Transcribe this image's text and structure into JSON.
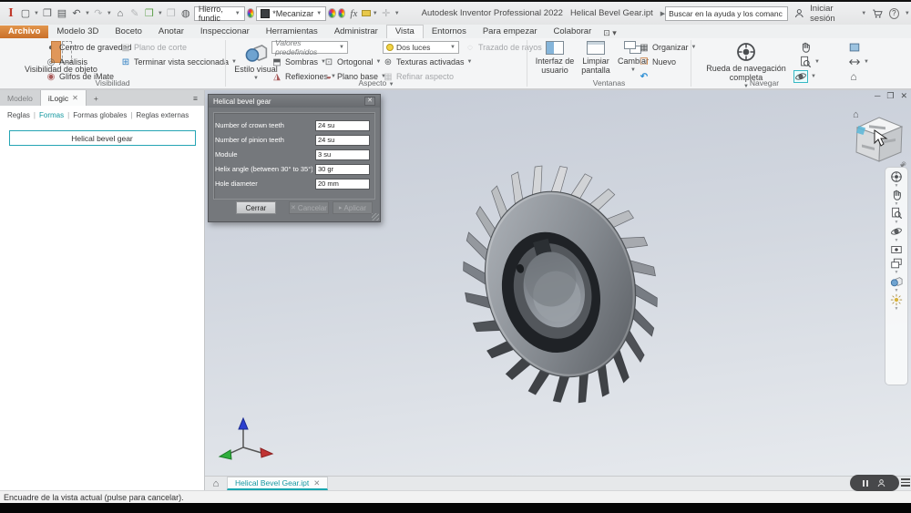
{
  "titlebar": {
    "app_title": "Autodesk Inventor Professional 2022",
    "doc_title": "Helical Bevel Gear.ipt",
    "material_dropdown": "Hierro, fundic",
    "appearance_dropdown": "*Mecanizar",
    "fx_label": "fx",
    "search_value": "Buscar en la ayuda y los comanc",
    "sign_in_label": "Iniciar sesión"
  },
  "ribbon": {
    "tabs": [
      "Archivo",
      "Modelo 3D",
      "Boceto",
      "Anotar",
      "Inspeccionar",
      "Herramientas",
      "Administrar",
      "Vista",
      "Entornos",
      "Para empezar",
      "Colaborar"
    ],
    "active_tab": "Vista",
    "visibilidad": {
      "label": "Visibilidad",
      "big_button": "Visibilidad de objeto",
      "centro": "Centro de gravedad",
      "analisis": "Análisis",
      "glifos": "Glifos de iMate",
      "plano_corte": "Plano de corte",
      "terminar": "Terminar vista seccionada"
    },
    "aspecto": {
      "label": "Aspecto",
      "big_button": "Estilo visual",
      "preset": "Valores predefinidos",
      "sombras": "Sombras",
      "ortogonal": "Ortogonal",
      "reflexiones": "Reflexiones",
      "plano_base": "Plano base",
      "luces": "Dos luces",
      "texturas": "Texturas activadas",
      "trazado": "Trazado de rayos",
      "refinar": "Refinar aspecto"
    },
    "ventanas": {
      "label": "Ventanas",
      "interfaz": "Interfaz de usuario",
      "limpiar": "Limpiar pantalla",
      "cambiar": "Cambiar",
      "organizar": "Organizar",
      "nuevo": "Nuevo"
    },
    "navegar": {
      "label": "Navegar",
      "big_button": "Rueda de navegación completa"
    }
  },
  "browser": {
    "tab_modelo": "Modelo",
    "tab_ilogic": "iLogic",
    "links": [
      "Reglas",
      "Formas",
      "Formas globales",
      "Reglas externas"
    ],
    "form_button": "Helical bevel gear"
  },
  "dialog": {
    "title": "Helical bevel gear",
    "fields": [
      {
        "label": "Number of crown teeth",
        "value": "24 su"
      },
      {
        "label": "Number of pinion teeth",
        "value": "24 su"
      },
      {
        "label": "Module",
        "value": "3 su"
      },
      {
        "label": "Helix angle (between 30° to 35°)",
        "value": "30 gr"
      },
      {
        "label": "Hole diameter",
        "value": "20 mm"
      }
    ],
    "close_button": "Cerrar",
    "cancel_button": "Cancelar",
    "apply_button": "Aplicar"
  },
  "doc_tab": {
    "label": "Helical Bevel Gear.ipt"
  },
  "statusbar": {
    "message": "Encuadre de la vista actual (pulse para cancelar)."
  },
  "colors": {
    "accent_teal": "#18a7b0",
    "archivo_orange": "#d9772e",
    "viewport_top": "#c6ccd7",
    "viewport_bottom": "#e7eaee",
    "dialog_gray": "#75787c"
  }
}
